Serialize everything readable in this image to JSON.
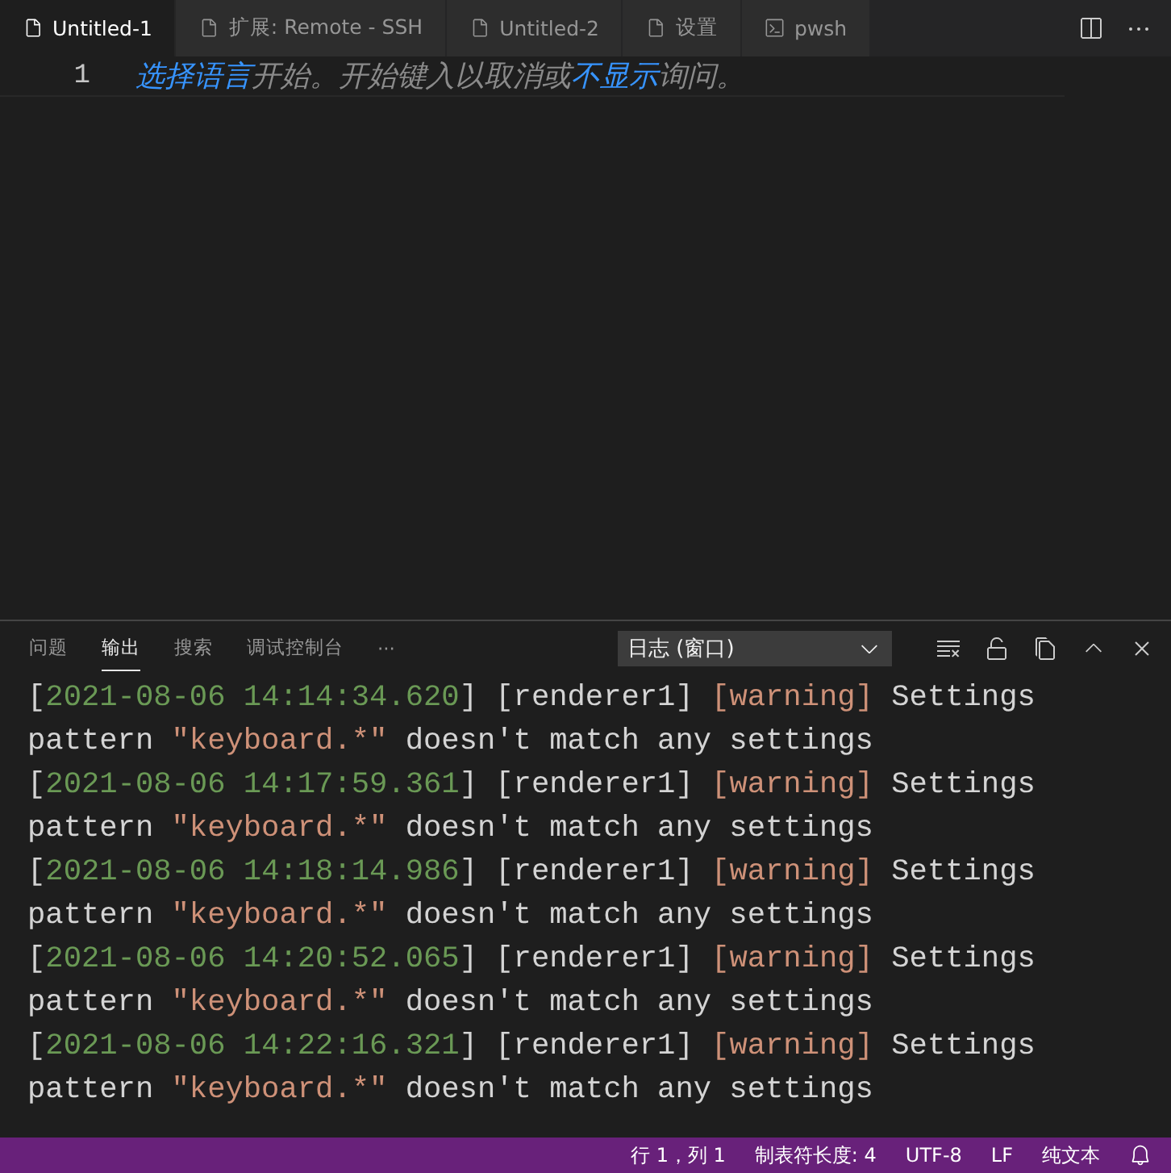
{
  "tabs": [
    {
      "label": "Untitled-1",
      "kind": "file",
      "selected": true
    },
    {
      "label": "扩展: Remote - SSH",
      "kind": "file",
      "selected": false
    },
    {
      "label": "Untitled-2",
      "kind": "file",
      "selected": false
    },
    {
      "label": "设置",
      "kind": "file",
      "selected": false
    },
    {
      "label": "pwsh",
      "kind": "terminal",
      "selected": false
    }
  ],
  "editor": {
    "line_number": "1",
    "segments": [
      {
        "kind": "link",
        "text": "选择语言"
      },
      {
        "kind": "hint",
        "text": "开始。开始键入以取消或"
      },
      {
        "kind": "link",
        "text": "不显示"
      },
      {
        "kind": "hint",
        "text": "询问。"
      }
    ]
  },
  "panel": {
    "tabs": [
      {
        "label": "问题",
        "selected": false
      },
      {
        "label": "输出",
        "selected": true
      },
      {
        "label": "搜索",
        "selected": false
      },
      {
        "label": "调试控制台",
        "selected": false
      }
    ],
    "more": "···",
    "channel": "日志 (窗口)",
    "lines": [
      [
        {
          "kind": "plain",
          "text": "["
        },
        {
          "kind": "time",
          "text": "2021-08-06 14:14:34.620"
        },
        {
          "kind": "plain",
          "text": "] [renderer1] "
        },
        {
          "kind": "level",
          "text": "[warning]"
        },
        {
          "kind": "plain",
          "text": " Settings"
        }
      ],
      [
        {
          "kind": "plain",
          "text": "pattern "
        },
        {
          "kind": "string",
          "text": "\"keyboard.*\""
        },
        {
          "kind": "plain",
          "text": " doesn't match any settings"
        }
      ],
      [
        {
          "kind": "plain",
          "text": "["
        },
        {
          "kind": "time",
          "text": "2021-08-06 14:17:59.361"
        },
        {
          "kind": "plain",
          "text": "] [renderer1] "
        },
        {
          "kind": "level",
          "text": "[warning]"
        },
        {
          "kind": "plain",
          "text": " Settings"
        }
      ],
      [
        {
          "kind": "plain",
          "text": "pattern "
        },
        {
          "kind": "string",
          "text": "\"keyboard.*\""
        },
        {
          "kind": "plain",
          "text": " doesn't match any settings"
        }
      ],
      [
        {
          "kind": "plain",
          "text": "["
        },
        {
          "kind": "time",
          "text": "2021-08-06 14:18:14.986"
        },
        {
          "kind": "plain",
          "text": "] [renderer1] "
        },
        {
          "kind": "level",
          "text": "[warning]"
        },
        {
          "kind": "plain",
          "text": " Settings"
        }
      ],
      [
        {
          "kind": "plain",
          "text": "pattern "
        },
        {
          "kind": "string",
          "text": "\"keyboard.*\""
        },
        {
          "kind": "plain",
          "text": " doesn't match any settings"
        }
      ],
      [
        {
          "kind": "plain",
          "text": "["
        },
        {
          "kind": "time",
          "text": "2021-08-06 14:20:52.065"
        },
        {
          "kind": "plain",
          "text": "] [renderer1] "
        },
        {
          "kind": "level",
          "text": "[warning]"
        },
        {
          "kind": "plain",
          "text": " Settings"
        }
      ],
      [
        {
          "kind": "plain",
          "text": "pattern "
        },
        {
          "kind": "string",
          "text": "\"keyboard.*\""
        },
        {
          "kind": "plain",
          "text": " doesn't match any settings"
        }
      ],
      [
        {
          "kind": "plain",
          "text": "["
        },
        {
          "kind": "time",
          "text": "2021-08-06 14:22:16.321"
        },
        {
          "kind": "plain",
          "text": "] [renderer1] "
        },
        {
          "kind": "level",
          "text": "[warning]"
        },
        {
          "kind": "plain",
          "text": " Settings"
        }
      ],
      [
        {
          "kind": "plain",
          "text": "pattern "
        },
        {
          "kind": "string",
          "text": "\"keyboard.*\""
        },
        {
          "kind": "plain",
          "text": " doesn't match any settings"
        }
      ]
    ]
  },
  "status_bar": [
    "行 1，列 1",
    "制表符长度: 4",
    "UTF-8",
    "LF",
    "纯文本"
  ]
}
